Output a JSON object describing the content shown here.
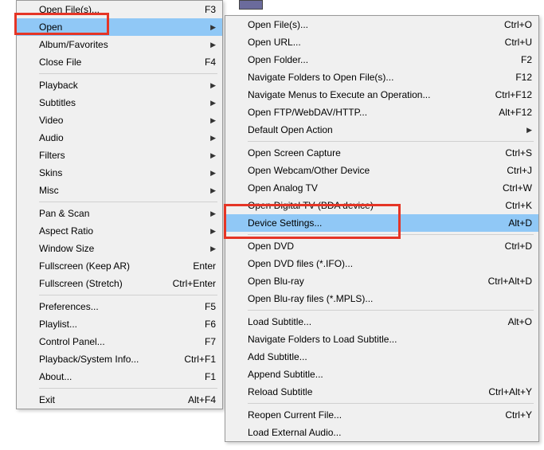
{
  "leftMenu": {
    "groups": [
      [
        {
          "id": "open-files",
          "label": "Open File(s)...",
          "shortcut": "F3",
          "sub": false
        },
        {
          "id": "open",
          "label": "Open",
          "shortcut": "",
          "sub": true,
          "hl": true
        },
        {
          "id": "album-favorites",
          "label": "Album/Favorites",
          "shortcut": "",
          "sub": true
        },
        {
          "id": "close-file",
          "label": "Close File",
          "shortcut": "F4",
          "sub": false
        }
      ],
      [
        {
          "id": "playback",
          "label": "Playback",
          "shortcut": "",
          "sub": true
        },
        {
          "id": "subtitles",
          "label": "Subtitles",
          "shortcut": "",
          "sub": true
        },
        {
          "id": "video",
          "label": "Video",
          "shortcut": "",
          "sub": true
        },
        {
          "id": "audio",
          "label": "Audio",
          "shortcut": "",
          "sub": true
        },
        {
          "id": "filters",
          "label": "Filters",
          "shortcut": "",
          "sub": true
        },
        {
          "id": "skins",
          "label": "Skins",
          "shortcut": "",
          "sub": true
        },
        {
          "id": "misc",
          "label": "Misc",
          "shortcut": "",
          "sub": true
        }
      ],
      [
        {
          "id": "pan-scan",
          "label": "Pan & Scan",
          "shortcut": "",
          "sub": true
        },
        {
          "id": "aspect-ratio",
          "label": "Aspect Ratio",
          "shortcut": "",
          "sub": true
        },
        {
          "id": "window-size",
          "label": "Window Size",
          "shortcut": "",
          "sub": true
        },
        {
          "id": "fullscreen-keep-ar",
          "label": "Fullscreen (Keep AR)",
          "shortcut": "Enter",
          "sub": false
        },
        {
          "id": "fullscreen-stretch",
          "label": "Fullscreen (Stretch)",
          "shortcut": "Ctrl+Enter",
          "sub": false
        }
      ],
      [
        {
          "id": "preferences",
          "label": "Preferences...",
          "shortcut": "F5",
          "sub": false
        },
        {
          "id": "playlist",
          "label": "Playlist...",
          "shortcut": "F6",
          "sub": false
        },
        {
          "id": "control-panel",
          "label": "Control Panel...",
          "shortcut": "F7",
          "sub": false
        },
        {
          "id": "playback-system-info",
          "label": "Playback/System Info...",
          "shortcut": "Ctrl+F1",
          "sub": false
        },
        {
          "id": "about",
          "label": "About...",
          "shortcut": "F1",
          "sub": false
        }
      ],
      [
        {
          "id": "exit",
          "label": "Exit",
          "shortcut": "Alt+F4",
          "sub": false
        }
      ]
    ]
  },
  "rightMenu": {
    "groups": [
      [
        {
          "id": "r-open-files",
          "label": "Open File(s)...",
          "shortcut": "Ctrl+O",
          "sub": false
        },
        {
          "id": "r-open-url",
          "label": "Open URL...",
          "shortcut": "Ctrl+U",
          "sub": false
        },
        {
          "id": "r-open-folder",
          "label": "Open Folder...",
          "shortcut": "F2",
          "sub": false
        },
        {
          "id": "r-nav-folders",
          "label": "Navigate Folders to Open File(s)...",
          "shortcut": "F12",
          "sub": false
        },
        {
          "id": "r-nav-menus",
          "label": "Navigate Menus to Execute an Operation...",
          "shortcut": "Ctrl+F12",
          "sub": false
        },
        {
          "id": "r-open-ftp",
          "label": "Open FTP/WebDAV/HTTP...",
          "shortcut": "Alt+F12",
          "sub": false
        },
        {
          "id": "r-default-open",
          "label": "Default Open Action",
          "shortcut": "",
          "sub": true
        }
      ],
      [
        {
          "id": "r-open-screen-capture",
          "label": "Open Screen Capture",
          "shortcut": "Ctrl+S",
          "sub": false
        },
        {
          "id": "r-open-webcam",
          "label": "Open Webcam/Other Device",
          "shortcut": "Ctrl+J",
          "sub": false
        },
        {
          "id": "r-open-analog-tv",
          "label": "Open Analog TV",
          "shortcut": "Ctrl+W",
          "sub": false
        },
        {
          "id": "r-open-digital-tv",
          "label": "Open Digital TV (BDA device)",
          "shortcut": "Ctrl+K",
          "sub": false
        },
        {
          "id": "r-device-settings",
          "label": "Device Settings...",
          "shortcut": "Alt+D",
          "sub": false,
          "hl": true
        }
      ],
      [
        {
          "id": "r-open-dvd",
          "label": "Open DVD",
          "shortcut": "Ctrl+D",
          "sub": false
        },
        {
          "id": "r-open-dvd-ifo",
          "label": "Open DVD files (*.IFO)...",
          "shortcut": "",
          "sub": false
        },
        {
          "id": "r-open-blu-ray",
          "label": "Open Blu-ray",
          "shortcut": "Ctrl+Alt+D",
          "sub": false
        },
        {
          "id": "r-open-blu-ray-mpls",
          "label": "Open Blu-ray files (*.MPLS)...",
          "shortcut": "",
          "sub": false
        }
      ],
      [
        {
          "id": "r-load-subtitle",
          "label": "Load Subtitle...",
          "shortcut": "Alt+O",
          "sub": false
        },
        {
          "id": "r-nav-folders-sub",
          "label": "Navigate Folders to Load Subtitle...",
          "shortcut": "",
          "sub": false
        },
        {
          "id": "r-add-subtitle",
          "label": "Add Subtitle...",
          "shortcut": "",
          "sub": false
        },
        {
          "id": "r-append-subtitle",
          "label": "Append Subtitle...",
          "shortcut": "",
          "sub": false
        },
        {
          "id": "r-reload-subtitle",
          "label": "Reload Subtitle",
          "shortcut": "Ctrl+Alt+Y",
          "sub": false
        }
      ],
      [
        {
          "id": "r-reopen-current",
          "label": "Reopen Current File...",
          "shortcut": "Ctrl+Y",
          "sub": false
        },
        {
          "id": "r-load-ext-audio",
          "label": "Load External Audio...",
          "shortcut": "",
          "sub": false
        }
      ]
    ]
  }
}
